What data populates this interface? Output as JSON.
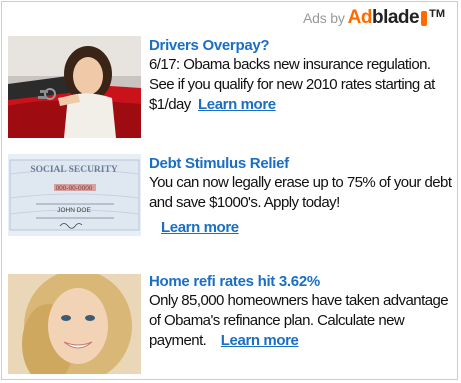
{
  "header": {
    "ads_by": "Ads by",
    "brand_ad": "Ad",
    "brand_blade": "blade",
    "trademark": "TM"
  },
  "colors": {
    "link": "#1a6fc4",
    "brand_orange": "#ff6a00",
    "text": "#111111",
    "muted": "#999999"
  },
  "ads": [
    {
      "headline": "Drivers Overpay?",
      "body": "6/17: Obama backs new insurance regulation. See if you qualify for new 2010 rates starting at $1/day",
      "link": "Learn more",
      "image": "woman-with-car-keys"
    },
    {
      "headline": "Debt Stimulus Relief",
      "body": "You can now legally erase up to 75% of your debt and save $1000's. Apply today!",
      "link": "Learn more",
      "image": "social-security-card",
      "card": {
        "title": "SOCIAL SECURITY",
        "number": "000-00-0000",
        "name": "JOHN DOE"
      }
    },
    {
      "headline": "Home refi rates hit 3.62%",
      "body": "Only 85,000 homeowners have taken advantage of Obama's refinance plan. Calculate new payment.",
      "link": "Learn more",
      "image": "smiling-blonde-woman"
    }
  ]
}
